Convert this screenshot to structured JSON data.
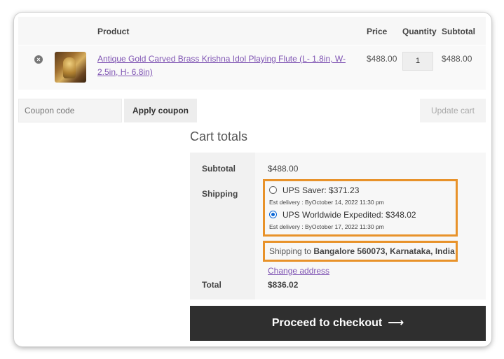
{
  "cart_table": {
    "headers": {
      "product": "Product",
      "price": "Price",
      "quantity": "Quantity",
      "subtotal": "Subtotal"
    },
    "items": [
      {
        "remove_icon": "close-circle-icon",
        "name": "Antique Gold Carved Brass Krishna Idol Playing Flute (L- 1.8in, W- 2.5in, H- 6.8in)",
        "price": "$488.00",
        "quantity": "1",
        "subtotal": "$488.00"
      }
    ]
  },
  "coupon": {
    "placeholder": "Coupon code",
    "apply_label": "Apply coupon",
    "update_label": "Update cart"
  },
  "cart_totals": {
    "title": "Cart totals",
    "subtotal_label": "Subtotal",
    "subtotal_value": "$488.00",
    "shipping_label": "Shipping",
    "shipping_options": [
      {
        "label": "UPS Saver: $371.23",
        "est": "Est delivery : ByOctober 14, 2022 11:30 pm",
        "selected": false
      },
      {
        "label": "UPS Worldwide Expedited: $348.02",
        "est": "Est delivery : ByOctober 17, 2022 11:30 pm",
        "selected": true
      }
    ],
    "shipping_to_prefix": "Shipping to ",
    "shipping_to_place": "Bangalore 560073, Karnataka, India",
    "shipping_to_suffix": ".",
    "change_address": "Change address",
    "total_label": "Total",
    "total_value": "$836.02"
  },
  "checkout": {
    "label": "Proceed to checkout",
    "arrow_icon": "arrow-right-icon",
    "arrow_glyph": "⟶"
  },
  "colors": {
    "highlight": "#e8922a",
    "link": "#7f54b3",
    "checkout_bg": "#2f2f2f"
  }
}
